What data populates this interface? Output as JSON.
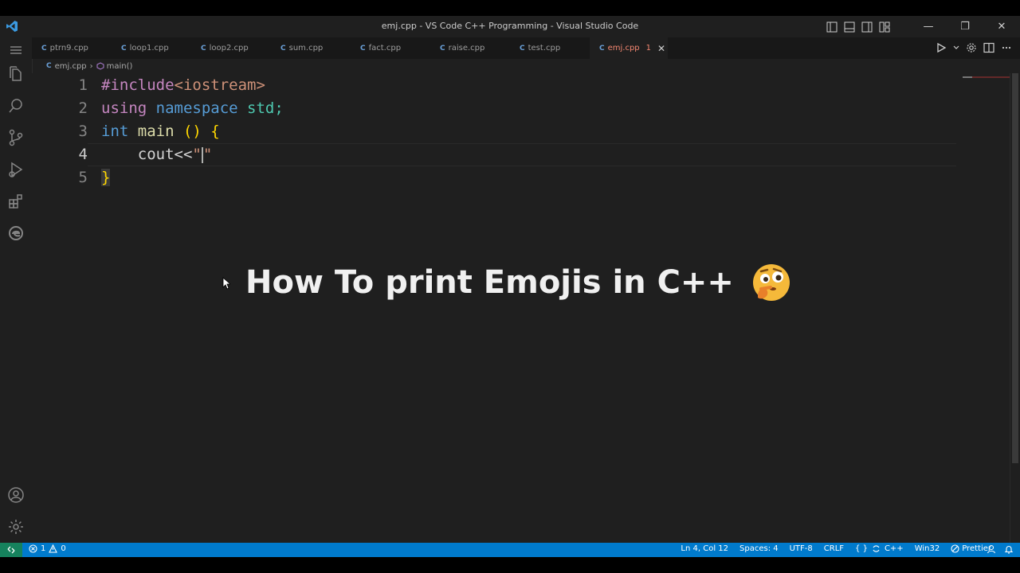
{
  "window": {
    "title": "emj.cpp - VS Code C++ Programming - Visual Studio Code",
    "controls": {
      "minimize": "—",
      "restore": "❐",
      "close": "✕"
    }
  },
  "tabs": [
    {
      "label": "ptrn9.cpp",
      "icon": "cpp-file-icon"
    },
    {
      "label": "loop1.cpp",
      "icon": "cpp-file-icon"
    },
    {
      "label": "loop2.cpp",
      "icon": "cpp-file-icon"
    },
    {
      "label": "sum.cpp",
      "icon": "cpp-file-icon"
    },
    {
      "label": "fact.cpp",
      "icon": "cpp-file-icon"
    },
    {
      "label": "raise.cpp",
      "icon": "cpp-file-icon"
    },
    {
      "label": "test.cpp",
      "icon": "cpp-file-icon"
    },
    {
      "label": "emj.cpp",
      "icon": "cpp-file-icon",
      "active": true,
      "problems": "1",
      "close": "✕"
    }
  ],
  "breadcrumb": {
    "file": "emj.cpp",
    "symbol": "main()"
  },
  "editor": {
    "line_numbers": [
      "1",
      "2",
      "3",
      "4",
      "5"
    ],
    "lines": {
      "l1_directive": "#include",
      "l1_header": "<iostream>",
      "l2_using": "using",
      "l2_namespace": "namespace",
      "l2_std": " std;",
      "l3_int": "int",
      "l3_main": " main ",
      "l3_parens": "()",
      "l3_brace": " {",
      "l4_indent": "    ",
      "l4_cout": "cout<<",
      "l4_quote1": "\"",
      "l4_quote2": "\"",
      "l5_brace": "}"
    }
  },
  "overlay_caption": "How To print Emojis in C++",
  "statusbar": {
    "errors": "1",
    "warnings": "0",
    "position": "Ln 4, Col 12",
    "spaces": "Spaces: 4",
    "encoding": "UTF-8",
    "eol": "CRLF",
    "language_braces": "{ }",
    "language": "C++",
    "platform": "Win32",
    "prettier": "Prettier"
  },
  "colors": {
    "statusbar": "#007acc",
    "remote": "#16825d",
    "active_tab_text": "#f48771"
  }
}
